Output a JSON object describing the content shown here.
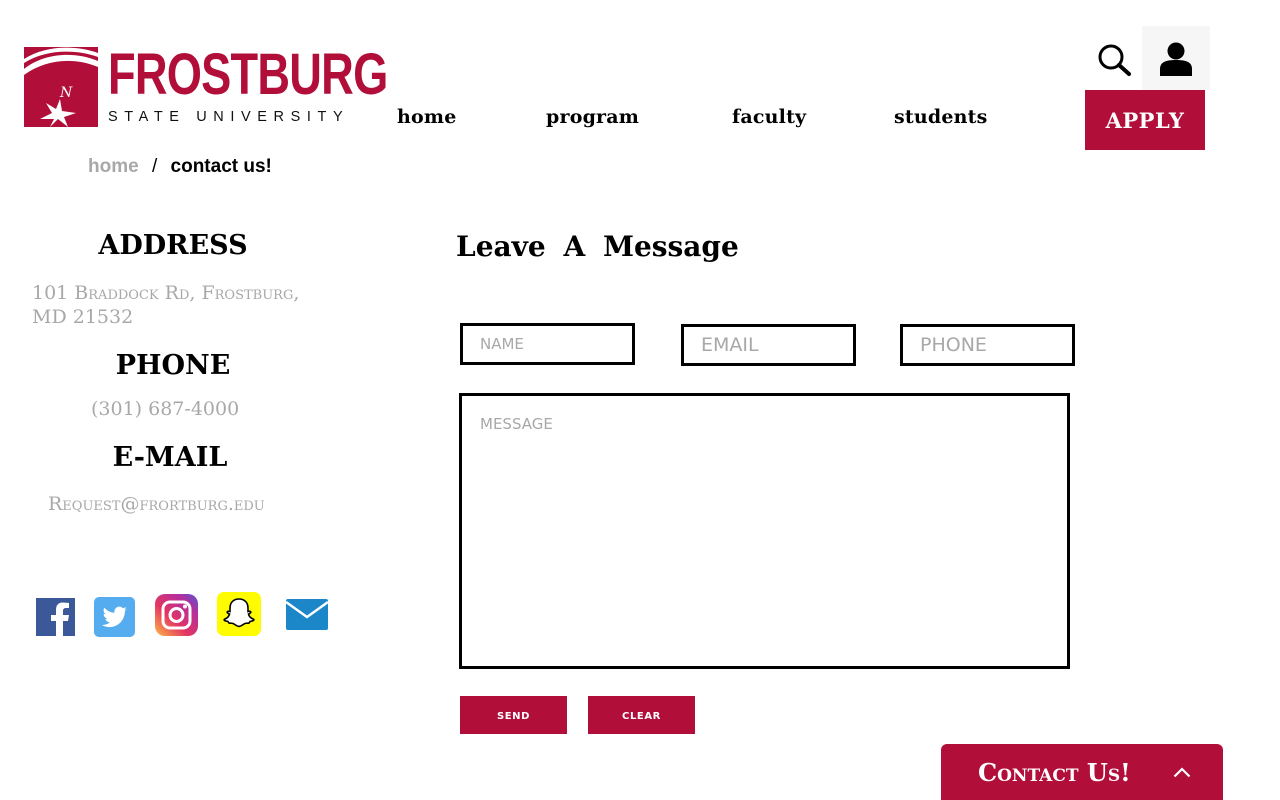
{
  "header": {
    "logo": {
      "name": "FROSTBURG",
      "subtitle": "STATE UNIVERSITY"
    },
    "nav": [
      {
        "label": "home"
      },
      {
        "label": "program"
      },
      {
        "label": "faculty"
      },
      {
        "label": "students"
      }
    ],
    "apply_label": "APPLY",
    "icons": {
      "search": "search-icon",
      "account": "user-icon"
    }
  },
  "breadcrumb": {
    "home": "home",
    "separator": "/",
    "current": "contact us!"
  },
  "sidebar": {
    "address_heading": "ADDRESS",
    "address_line1": "101 Braddock Rd, Frostburg,",
    "address_line2": "MD 21532",
    "phone_heading": "PHONE",
    "phone": "(301) 687-4000",
    "email_heading": "E-MAIL",
    "email": "Request@frortburg.edu",
    "socials": [
      "facebook-icon",
      "twitter-icon",
      "instagram-icon",
      "snapchat-icon",
      "mail-icon"
    ]
  },
  "form": {
    "title": "Leave A Message",
    "name_placeholder": "NAME",
    "email_placeholder": "EMAIL",
    "phone_placeholder": "PHONE",
    "message_placeholder": "MESSAGE",
    "send_label": "send",
    "clear_label": "clear"
  },
  "contact_tab": {
    "label": "Contact Us!"
  },
  "colors": {
    "brand": "#b10e3a",
    "muted_text": "#a8a8a8"
  }
}
